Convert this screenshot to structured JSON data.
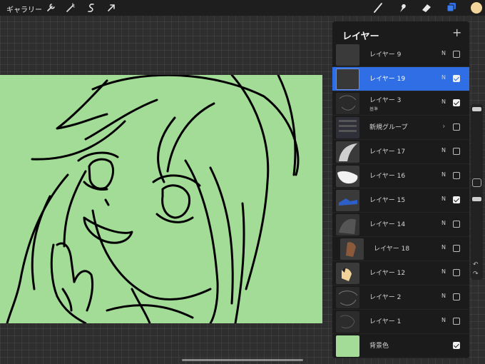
{
  "toolbar": {
    "gallery_label": "ギャラリー",
    "left_icons": [
      "wrench-icon",
      "magic-wand-icon",
      "selection-icon",
      "transform-arrow-icon"
    ],
    "right_icons": [
      "brush-icon",
      "smudge-icon",
      "eraser-icon",
      "layers-icon",
      "color-swatch-icon"
    ],
    "accent_color": "#2f6ee4",
    "current_color": "#f2d39a"
  },
  "canvas": {
    "background_color": "#a3dc97"
  },
  "layers_panel": {
    "title": "レイヤー",
    "add_label": "+",
    "layers": [
      {
        "name": "レイヤー 9",
        "blend": "N",
        "visible": false,
        "selected": false
      },
      {
        "name": "レイヤー 19",
        "blend": "N",
        "visible": true,
        "selected": true
      },
      {
        "name": "レイヤー 3",
        "sub": "基準",
        "blend": "N",
        "visible": true,
        "selected": false
      },
      {
        "name": "新規グループ",
        "blend": "",
        "visible": false,
        "selected": false,
        "group": true
      },
      {
        "name": "レイヤー 17",
        "blend": "N",
        "visible": false,
        "selected": false
      },
      {
        "name": "レイヤー 16",
        "blend": "N",
        "visible": false,
        "selected": false
      },
      {
        "name": "レイヤー 15",
        "blend": "N",
        "visible": true,
        "selected": false
      },
      {
        "name": "レイヤー 14",
        "blend": "N",
        "visible": false,
        "selected": false
      },
      {
        "name": "レイヤー 18",
        "blend": "N",
        "visible": false,
        "selected": false,
        "indented": true
      },
      {
        "name": "レイヤー 12",
        "blend": "N",
        "visible": false,
        "selected": false
      },
      {
        "name": "レイヤー 2",
        "blend": "N",
        "visible": false,
        "selected": false
      },
      {
        "name": "レイヤー 1",
        "blend": "N",
        "visible": false,
        "selected": false
      },
      {
        "name": "背景色",
        "blend": "",
        "visible": true,
        "selected": false
      }
    ]
  }
}
